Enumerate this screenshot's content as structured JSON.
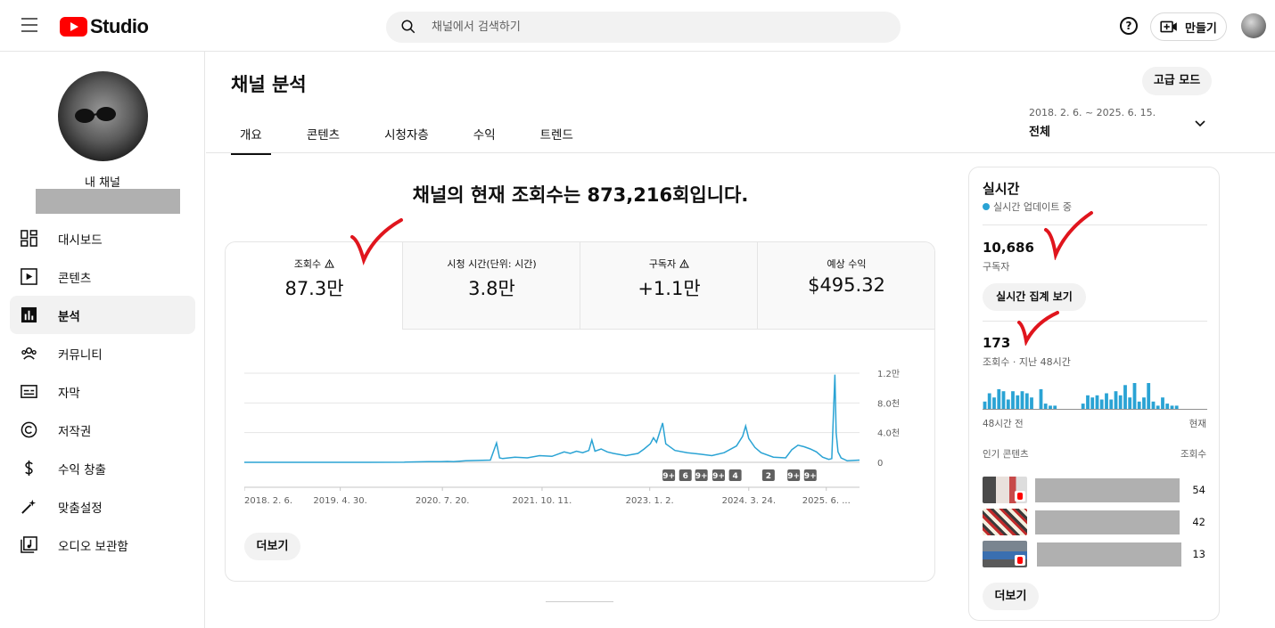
{
  "header": {
    "logo_text": "Studio",
    "search_placeholder": "채널에서 검색하기",
    "help_glyph": "?",
    "create_label": "만들기"
  },
  "sidebar": {
    "channel_label": "내 채널",
    "items": [
      {
        "label": "대시보드",
        "icon": "dashboard-icon",
        "active": false
      },
      {
        "label": "콘텐츠",
        "icon": "content-icon",
        "active": false
      },
      {
        "label": "분석",
        "icon": "analytics-icon",
        "active": true
      },
      {
        "label": "커뮤니티",
        "icon": "community-icon",
        "active": false
      },
      {
        "label": "자막",
        "icon": "subtitles-icon",
        "active": false
      },
      {
        "label": "저작권",
        "icon": "copyright-icon",
        "active": false
      },
      {
        "label": "수익 창출",
        "icon": "monetization-icon",
        "active": false
      },
      {
        "label": "맞춤설정",
        "icon": "customization-icon",
        "active": false
      },
      {
        "label": "오디오 보관함",
        "icon": "audio-library-icon",
        "active": false
      }
    ]
  },
  "main": {
    "title": "채널 분석",
    "advanced_mode": "고급 모드",
    "tabs": [
      {
        "label": "개요",
        "active": true
      },
      {
        "label": "콘텐츠",
        "active": false
      },
      {
        "label": "시청자층",
        "active": false
      },
      {
        "label": "수익",
        "active": false
      },
      {
        "label": "트렌드",
        "active": false
      }
    ],
    "date_range": "2018. 2. 6. ~ 2025. 6. 15.",
    "date_scope": "전체",
    "headline": "채널의 현재 조회수는 873,216회입니다.",
    "metrics": [
      {
        "label": "조회수",
        "value": "87.3만",
        "warning": true,
        "active": true
      },
      {
        "label": "시청 시간(단위: 시간)",
        "value": "3.8만",
        "warning": false,
        "active": false
      },
      {
        "label": "구독자",
        "value": "+1.1만",
        "warning": true,
        "active": false
      },
      {
        "label": "예상 수익",
        "value": "$495.32",
        "warning": false,
        "active": false
      }
    ],
    "more_label": "더보기"
  },
  "chart_data": {
    "type": "line",
    "series_color": "#2aa3d4",
    "ylim": [
      0,
      12000
    ],
    "y_ticks": [
      {
        "value": 0,
        "label": "0"
      },
      {
        "value": 4000,
        "label": "4.0천"
      },
      {
        "value": 8000,
        "label": "8.0천"
      },
      {
        "value": 12000,
        "label": "1.2만"
      }
    ],
    "x_tick_labels": [
      "2018. 2. 6.",
      "2019. 4. 30.",
      "2020. 7. 20.",
      "2021. 10. 11.",
      "2023. 1. 2.",
      "2024. 3. 24.",
      "2025. 6. ..."
    ],
    "x_tick_positions": [
      0,
      0.156,
      0.322,
      0.484,
      0.659,
      0.82,
      0.946
    ],
    "series": [
      {
        "points": [
          [
            0.0,
            0
          ],
          [
            0.1,
            0
          ],
          [
            0.2,
            0
          ],
          [
            0.26,
            10
          ],
          [
            0.262,
            40
          ],
          [
            0.28,
            60
          ],
          [
            0.3,
            90
          ],
          [
            0.32,
            80
          ],
          [
            0.33,
            120
          ],
          [
            0.34,
            100
          ],
          [
            0.36,
            200
          ],
          [
            0.38,
            250
          ],
          [
            0.4,
            300
          ],
          [
            0.41,
            2600
          ],
          [
            0.415,
            600
          ],
          [
            0.42,
            500
          ],
          [
            0.44,
            700
          ],
          [
            0.46,
            600
          ],
          [
            0.48,
            900
          ],
          [
            0.5,
            800
          ],
          [
            0.52,
            1400
          ],
          [
            0.53,
            1200
          ],
          [
            0.54,
            1500
          ],
          [
            0.55,
            1300
          ],
          [
            0.56,
            1600
          ],
          [
            0.565,
            3000
          ],
          [
            0.57,
            1500
          ],
          [
            0.58,
            1800
          ],
          [
            0.59,
            1400
          ],
          [
            0.6,
            1200
          ],
          [
            0.62,
            900
          ],
          [
            0.64,
            1200
          ],
          [
            0.65,
            1800
          ],
          [
            0.66,
            2500
          ],
          [
            0.665,
            3300
          ],
          [
            0.67,
            2700
          ],
          [
            0.68,
            5300
          ],
          [
            0.685,
            2500
          ],
          [
            0.69,
            2200
          ],
          [
            0.7,
            1600
          ],
          [
            0.72,
            1300
          ],
          [
            0.74,
            1100
          ],
          [
            0.76,
            900
          ],
          [
            0.78,
            1300
          ],
          [
            0.8,
            2200
          ],
          [
            0.81,
            3500
          ],
          [
            0.815,
            4900
          ],
          [
            0.82,
            3200
          ],
          [
            0.83,
            2000
          ],
          [
            0.84,
            1300
          ],
          [
            0.86,
            700
          ],
          [
            0.88,
            600
          ],
          [
            0.89,
            1700
          ],
          [
            0.9,
            2300
          ],
          [
            0.91,
            2100
          ],
          [
            0.92,
            1800
          ],
          [
            0.93,
            1400
          ],
          [
            0.94,
            700
          ],
          [
            0.95,
            400
          ],
          [
            0.955,
            500
          ],
          [
            0.96,
            11800
          ],
          [
            0.962,
            4000
          ],
          [
            0.965,
            1400
          ],
          [
            0.97,
            600
          ],
          [
            0.98,
            200
          ],
          [
            1.0,
            300
          ]
        ]
      }
    ],
    "annotations": [
      {
        "x": 0.69,
        "label": "9+"
      },
      {
        "x": 0.717,
        "label": "6"
      },
      {
        "x": 0.743,
        "label": "9+"
      },
      {
        "x": 0.771,
        "label": "9+"
      },
      {
        "x": 0.798,
        "label": "4"
      },
      {
        "x": 0.852,
        "label": "2"
      },
      {
        "x": 0.893,
        "label": "9+"
      },
      {
        "x": 0.92,
        "label": "9+"
      }
    ]
  },
  "realtime": {
    "title": "실시간",
    "live_label": "실시간 업데이트 중",
    "subscribers_value": "10,686",
    "subscribers_label": "구독자",
    "aggregate_button": "실시간 집계 보기",
    "views_value": "173",
    "views_label": "조회수 · 지난 48시간",
    "bars": [
      4,
      8,
      6,
      10,
      9,
      5,
      9,
      7,
      9,
      8,
      6,
      0,
      10,
      3,
      2,
      2,
      0,
      0,
      0,
      0,
      0,
      3,
      7,
      6,
      7,
      5,
      8,
      5,
      9,
      7,
      12,
      6,
      13,
      4,
      6,
      13,
      4,
      2,
      6,
      3,
      2,
      2,
      0,
      0,
      0,
      0,
      0,
      0
    ],
    "left_axis_label": "48시간 전",
    "right_axis_label": "현재",
    "popular_header": "인기 콘텐츠",
    "popular_views_header": "조회수",
    "popular": [
      {
        "views": "54"
      },
      {
        "views": "42"
      },
      {
        "views": "13"
      }
    ],
    "more_label": "더보기",
    "bar_color": "#2aa3d4"
  }
}
